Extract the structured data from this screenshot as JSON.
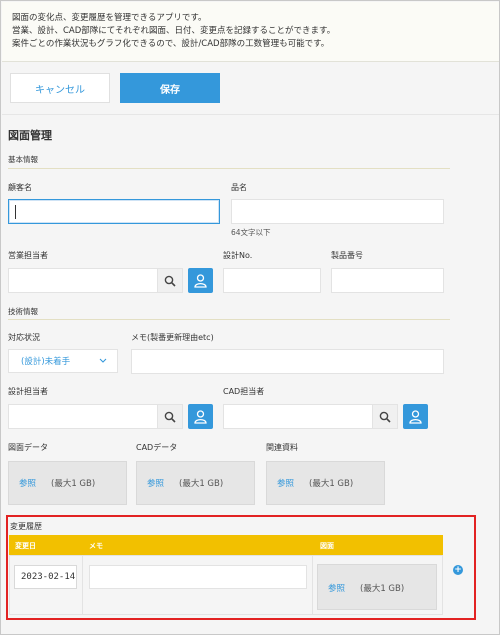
{
  "banner": {
    "lines": [
      "図面の変化点、変更履歴を管理できるアプリです。",
      "営業、設計、CAD部隊にてそれぞれ図面、日付、変更点を記録することができます。",
      "案件ごとの作業状況もグラフ化できるので、設計/CAD部隊の工数管理も可能です。"
    ]
  },
  "toolbar": {
    "cancel_label": "キャンセル",
    "save_label": "保存"
  },
  "form": {
    "title": "図面管理",
    "sections": {
      "basic": "基本情報",
      "tech": "技術情報"
    },
    "fields": {
      "customer_name": {
        "label": "顧客名",
        "value": ""
      },
      "product_name": {
        "label": "品名",
        "value": "",
        "hint": "64文字以下"
      },
      "sales_person": {
        "label": "営業担当者",
        "value": ""
      },
      "design_no": {
        "label": "設計No.",
        "value": ""
      },
      "product_no": {
        "label": "製品番号",
        "value": ""
      },
      "status": {
        "label": "対応状況",
        "value": "(設計)未着手"
      },
      "memo": {
        "label": "メモ(製番更新理由etc)",
        "value": ""
      },
      "designer": {
        "label": "設計担当者",
        "value": ""
      },
      "cad_person": {
        "label": "CAD担当者",
        "value": ""
      }
    },
    "uploads": [
      {
        "label": "図面データ",
        "browse": "参照",
        "max": "(最大1 GB)"
      },
      {
        "label": "CADデータ",
        "browse": "参照",
        "max": "(最大1 GB)"
      },
      {
        "label": "関連資料",
        "browse": "参照",
        "max": "(最大1 GB)"
      }
    ],
    "history": {
      "label": "変更履歴",
      "columns": [
        "変更日",
        "メモ",
        "図面"
      ],
      "rows": [
        {
          "date": "2023-02-14",
          "memo": "",
          "browse": "参照",
          "max": "(最大1 GB)"
        }
      ],
      "add_icon": "plus-circle-icon"
    }
  },
  "colors": {
    "accent": "#3498db",
    "table_header": "#f2c000",
    "highlight_border": "#e22222"
  }
}
